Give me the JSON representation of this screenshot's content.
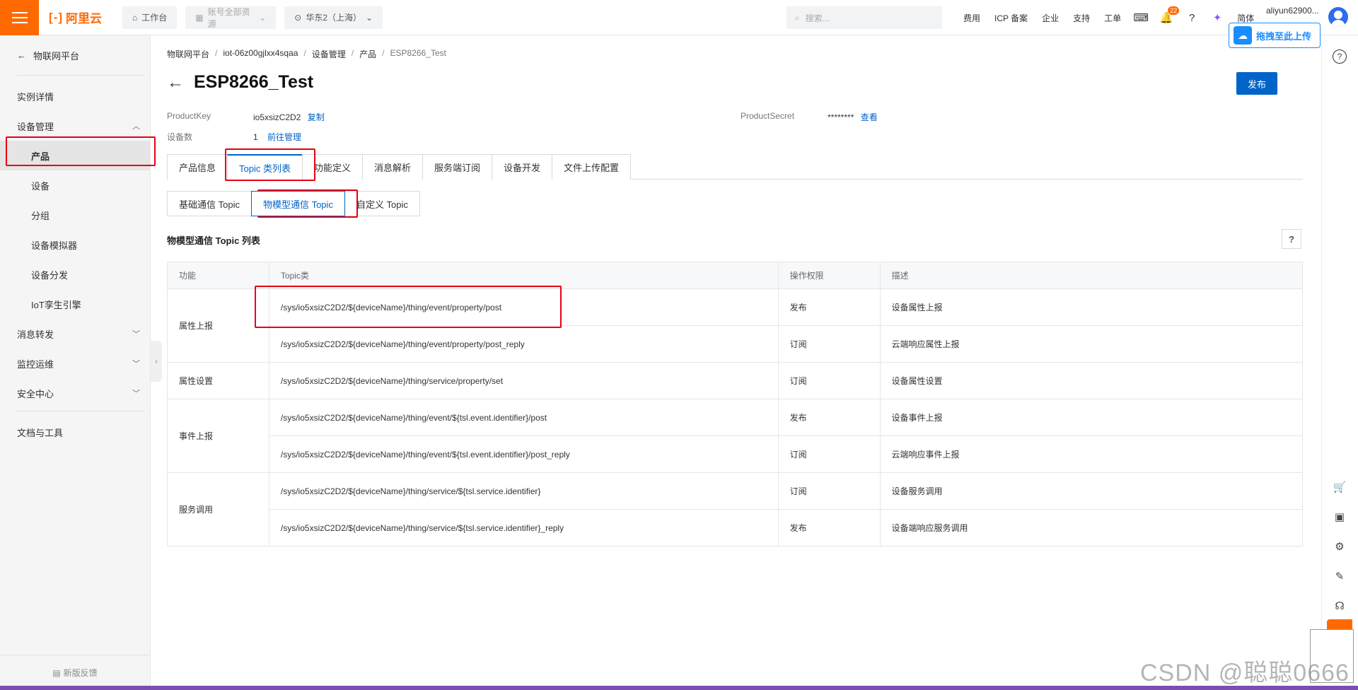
{
  "topbar": {
    "logo_text": "阿里云",
    "workbench": "工作台",
    "resources": "账号全部资源",
    "region": "华东2（上海）",
    "search_placeholder": "搜索...",
    "links": [
      "费用",
      "ICP 备案",
      "企业",
      "支持",
      "工单"
    ],
    "notification_count": "22",
    "lang": "简体",
    "username": "aliyun62900...",
    "upload_label": "拖拽至此上传"
  },
  "sidebar": {
    "back_label": "物联网平台",
    "items": [
      {
        "label": "实例详情",
        "child": false,
        "chevron": ""
      },
      {
        "label": "设备管理",
        "child": false,
        "chevron": "up"
      },
      {
        "label": "产品",
        "child": true,
        "chevron": "",
        "active": true
      },
      {
        "label": "设备",
        "child": true,
        "chevron": ""
      },
      {
        "label": "分组",
        "child": true,
        "chevron": ""
      },
      {
        "label": "设备模拟器",
        "child": true,
        "chevron": ""
      },
      {
        "label": "设备分发",
        "child": true,
        "chevron": ""
      },
      {
        "label": "IoT孪生引擎",
        "child": true,
        "chevron": ""
      },
      {
        "label": "消息转发",
        "child": false,
        "chevron": "down"
      },
      {
        "label": "监控运维",
        "child": false,
        "chevron": "down"
      },
      {
        "label": "安全中心",
        "child": false,
        "chevron": "down"
      }
    ],
    "docs_label": "文档与工具",
    "feedback_label": "新版反馈"
  },
  "breadcrumb": [
    "物联网平台",
    "iot-06z00gjlxx4sqaa",
    "设备管理",
    "产品",
    "ESP8266_Test"
  ],
  "page_title": "ESP8266_Test",
  "publish_label": "发布",
  "meta": {
    "product_key_label": "ProductKey",
    "product_key_value": "io5xsizC2D2",
    "copy_label": "复制",
    "device_count_label": "设备数",
    "device_count_value": "1",
    "manage_label": "前往管理",
    "product_secret_label": "ProductSecret",
    "product_secret_value": "********",
    "view_label": "查看"
  },
  "tabs": [
    "产品信息",
    "Topic 类列表",
    "功能定义",
    "消息解析",
    "服务端订阅",
    "设备开发",
    "文件上传配置"
  ],
  "active_tab": 1,
  "subtabs": [
    "基础通信 Topic",
    "物模型通信 Topic",
    "自定义 Topic"
  ],
  "active_subtab": 1,
  "section_title": "物模型通信 Topic 列表",
  "table": {
    "headers": [
      "功能",
      "Topic类",
      "操作权限",
      "描述"
    ],
    "groups": [
      {
        "func": "属性上报",
        "rows": [
          {
            "topic": "/sys/io5xsizC2D2/${deviceName}/thing/event/property/post",
            "perm": "发布",
            "desc": "设备属性上报"
          },
          {
            "topic": "/sys/io5xsizC2D2/${deviceName}/thing/event/property/post_reply",
            "perm": "订阅",
            "desc": "云端响应属性上报"
          }
        ]
      },
      {
        "func": "属性设置",
        "rows": [
          {
            "topic": "/sys/io5xsizC2D2/${deviceName}/thing/service/property/set",
            "perm": "订阅",
            "desc": "设备属性设置"
          }
        ]
      },
      {
        "func": "事件上报",
        "rows": [
          {
            "topic": "/sys/io5xsizC2D2/${deviceName}/thing/event/${tsl.event.identifier}/post",
            "perm": "发布",
            "desc": "设备事件上报"
          },
          {
            "topic": "/sys/io5xsizC2D2/${deviceName}/thing/event/${tsl.event.identifier}/post_reply",
            "perm": "订阅",
            "desc": "云端响应事件上报"
          }
        ]
      },
      {
        "func": "服务调用",
        "rows": [
          {
            "topic": "/sys/io5xsizC2D2/${deviceName}/thing/service/${tsl.service.identifier}",
            "perm": "订阅",
            "desc": "设备服务调用"
          },
          {
            "topic": "/sys/io5xsizC2D2/${deviceName}/thing/service/${tsl.service.identifier}_reply",
            "perm": "发布",
            "desc": "设备端响应服务调用"
          }
        ]
      }
    ]
  },
  "watermark": "CSDN @聪聪0666",
  "colors": {
    "brand": "#ff6a00",
    "primary": "#0064c8",
    "highlight": "#e60012"
  }
}
